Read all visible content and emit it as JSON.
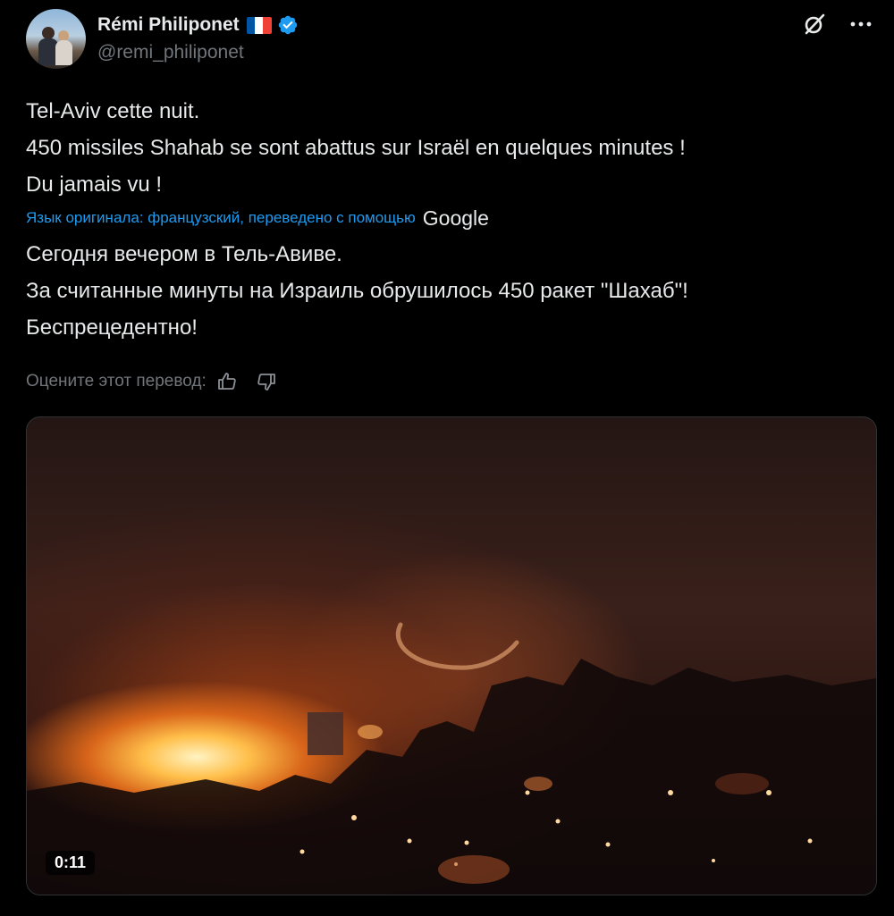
{
  "author": {
    "name": "Rémi Philiponet",
    "handle": "@remi_philiponet",
    "flag_colors": [
      "#0055a4",
      "#ffffff",
      "#ef4135"
    ],
    "verified_color": "#1d9bf0"
  },
  "header_icons": [
    "grok-icon",
    "more-icon"
  ],
  "tweet": {
    "lines": [
      "Tel-Aviv cette nuit.",
      "450 missiles Shahab se sont abattus sur Israël en quelques minutes !",
      "Du jamais vu !"
    ],
    "translation_note": "Язык оригинала: французский, переведено с помощью",
    "translation_provider": "Google",
    "translated_lines": [
      "Сегодня вечером в Тель-Авиве.",
      "За считанные минуты на Израиль обрушилось 450 ракет \"Шахаб\"!",
      "Беспрецедентно!"
    ],
    "rate_label": "Оцените этот перевод:"
  },
  "media": {
    "type": "video",
    "duration": "0:11"
  },
  "colors": {
    "background": "#000000",
    "text": "#e7e9ea",
    "secondary": "#71767b",
    "link": "#1d9bf0"
  }
}
